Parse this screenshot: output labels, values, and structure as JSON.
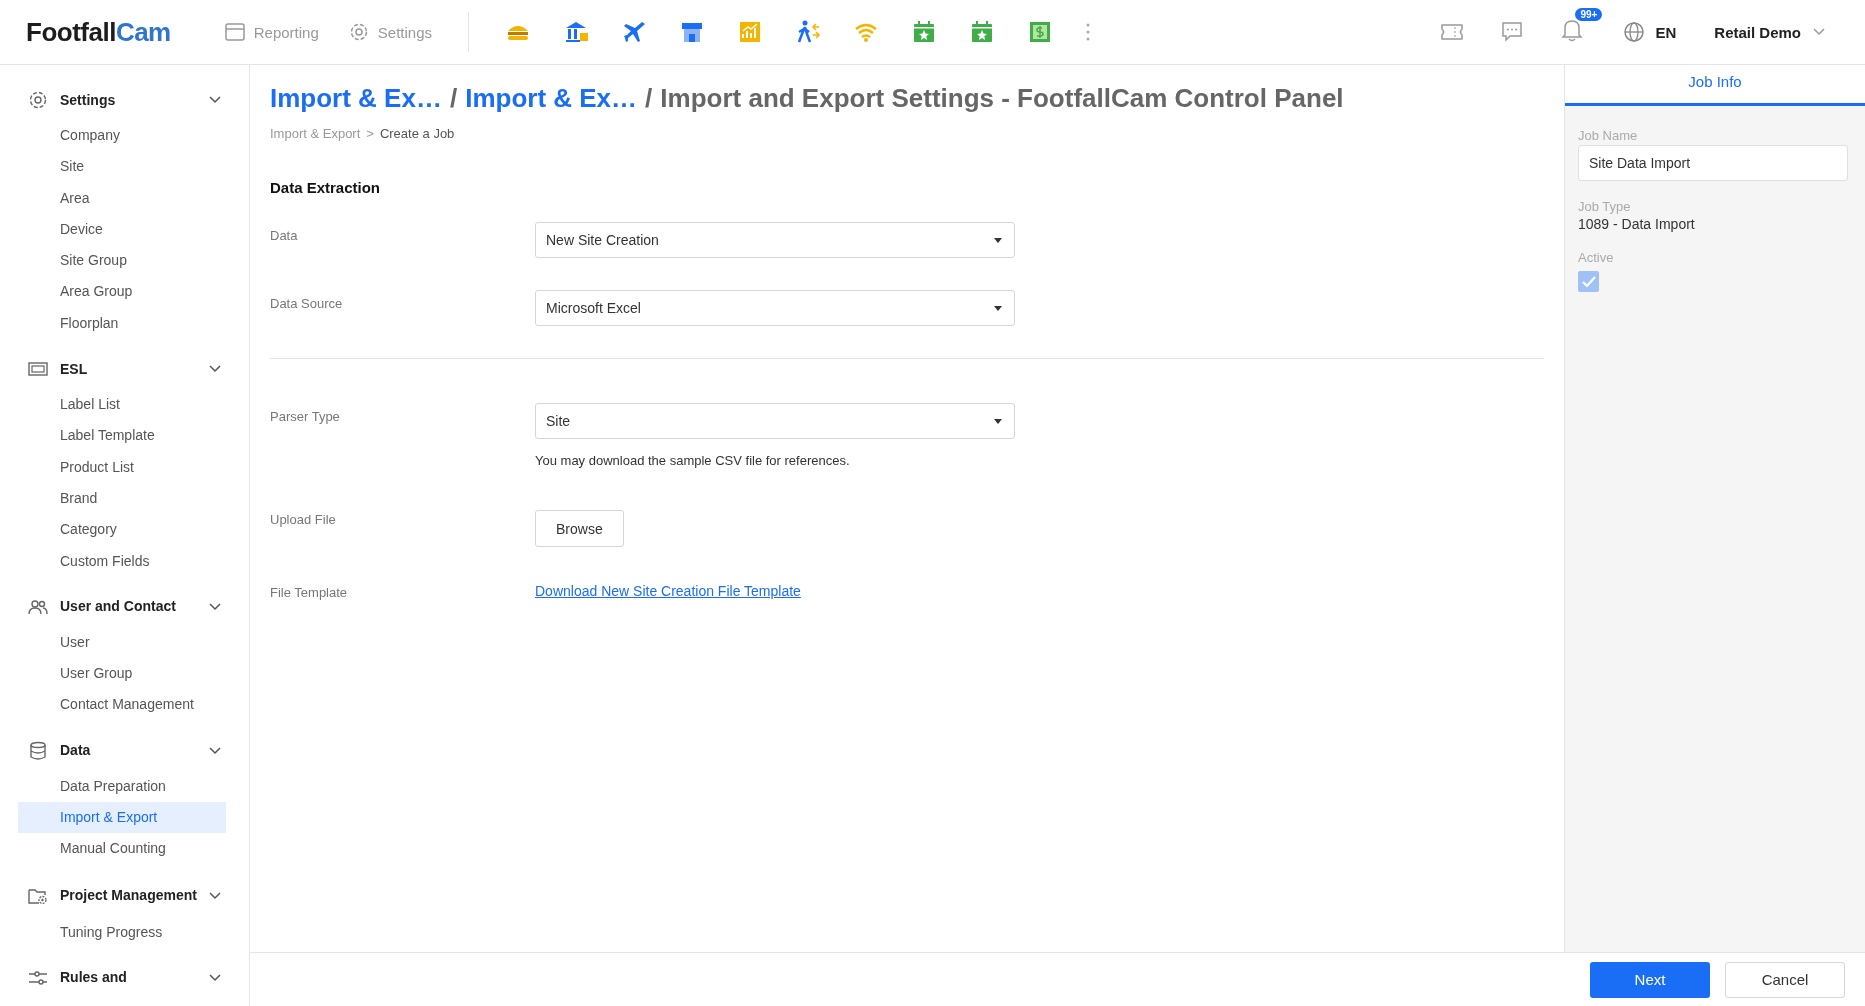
{
  "header": {
    "logo": {
      "first": "Footfall",
      "second": "Cam"
    },
    "nav": [
      {
        "kind": "reporting",
        "label": "Reporting"
      },
      {
        "kind": "settings",
        "label": "Settings"
      }
    ],
    "apps": [
      {
        "kind": "burger"
      },
      {
        "kind": "bank"
      },
      {
        "kind": "plane"
      },
      {
        "kind": "store"
      },
      {
        "kind": "chart"
      },
      {
        "kind": "walker"
      },
      {
        "kind": "wifi"
      },
      {
        "kind": "calendar"
      },
      {
        "kind": "calendar"
      },
      {
        "kind": "money"
      }
    ],
    "notification_badge": "99+",
    "language": "EN",
    "account": "Retail Demo"
  },
  "sidebar": {
    "groups": [
      {
        "kind": "gear",
        "title": "Settings",
        "expanded": true,
        "items": [
          {
            "label": "Company",
            "selected": false
          },
          {
            "label": "Site",
            "selected": false
          },
          {
            "label": "Area",
            "selected": false
          },
          {
            "label": "Device",
            "selected": false
          },
          {
            "label": "Site Group",
            "selected": false
          },
          {
            "label": "Area Group",
            "selected": false
          },
          {
            "label": "Floorplan",
            "selected": false
          }
        ]
      },
      {
        "kind": "screen",
        "title": "ESL",
        "expanded": true,
        "items": [
          {
            "label": "Label List",
            "selected": false
          },
          {
            "label": "Label Template",
            "selected": false
          },
          {
            "label": "Product List",
            "selected": false
          },
          {
            "label": "Brand",
            "selected": false
          },
          {
            "label": "Category",
            "selected": false
          },
          {
            "label": "Custom Fields",
            "selected": false
          }
        ]
      },
      {
        "kind": "users",
        "title": "User and Contact",
        "expanded": true,
        "items": [
          {
            "label": "User",
            "selected": false
          },
          {
            "label": "User Group",
            "selected": false
          },
          {
            "label": "Contact Management",
            "selected": false
          }
        ]
      },
      {
        "kind": "database",
        "title": "Data",
        "expanded": true,
        "items": [
          {
            "label": "Data Preparation",
            "selected": false
          },
          {
            "label": "Import & Export",
            "selected": true
          },
          {
            "label": "Manual Counting",
            "selected": false
          }
        ]
      },
      {
        "kind": "folder",
        "title": "Project Management",
        "expanded": true,
        "items": [
          {
            "label": "Tuning Progress",
            "selected": false
          }
        ]
      },
      {
        "kind": "sliders",
        "title": "Rules and",
        "expanded": true
      }
    ]
  },
  "page": {
    "title": {
      "separator": "/",
      "parts": [
        {
          "kind": "link",
          "text": "Import & Ex…"
        },
        {
          "kind": "link",
          "text": "Import & Ex…"
        },
        {
          "kind": "current",
          "text": "Import and Export Settings - FootfallCam Control Panel"
        }
      ]
    },
    "breadcrumb": {
      "separator": ">",
      "items": [
        "Import & Export",
        "Create a Job"
      ]
    },
    "section_title": "Data Extraction",
    "groups": [
      [
        {
          "kind": "select",
          "label": "Data",
          "value": "New Site Creation"
        },
        {
          "kind": "select",
          "label": "Data Source",
          "value": "Microsoft Excel"
        }
      ],
      [
        {
          "kind": "select",
          "label": "Parser Type",
          "value": "Site",
          "hint": "You may download the sample CSV file for references."
        },
        {
          "kind": "button",
          "label": "Upload File",
          "value": "Browse"
        },
        {
          "kind": "link",
          "label": "File Template",
          "value": "Download New Site Creation File Template"
        }
      ]
    ]
  },
  "job_panel": {
    "tabs": [
      {
        "label": "Job Info",
        "selected": true
      }
    ],
    "job_name": {
      "label": "Job Name",
      "value": "Site Data Import"
    },
    "job_type": {
      "label": "Job Type",
      "value": "1089 - Data Import"
    },
    "active": {
      "label": "Active",
      "checked": true,
      "disabled": true
    }
  },
  "footer": {
    "buttons": [
      {
        "kind": "primary",
        "label": "Next"
      },
      {
        "kind": "secondary",
        "label": "Cancel"
      }
    ]
  }
}
